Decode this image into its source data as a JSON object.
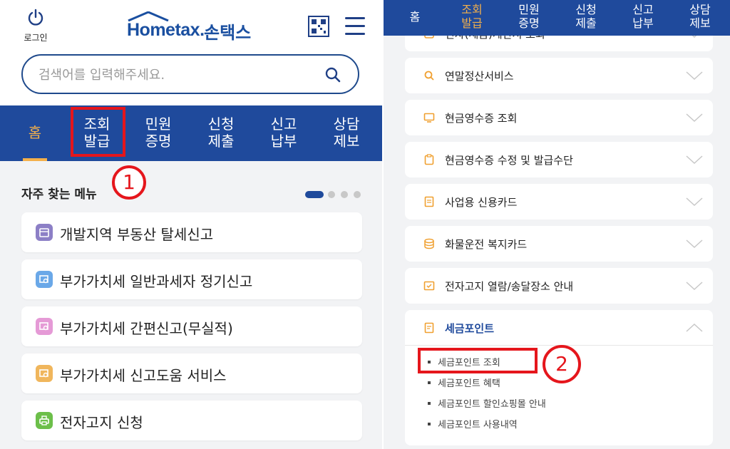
{
  "left": {
    "login_label": "로그인",
    "logo_text": "Hometax.",
    "logo_korean": "손택스",
    "search_placeholder": "검색어를 입력해주세요.",
    "nav": [
      {
        "label1": "홈",
        "label2": "",
        "active": true
      },
      {
        "label1": "조회",
        "label2": "발급",
        "active": false
      },
      {
        "label1": "민원",
        "label2": "증명",
        "active": false
      },
      {
        "label1": "신청",
        "label2": "제출",
        "active": false
      },
      {
        "label1": "신고",
        "label2": "납부",
        "active": false
      },
      {
        "label1": "상담",
        "label2": "제보",
        "active": false
      }
    ],
    "annotation_1": "1",
    "frequent_title": "자주 찾는 메뉴",
    "frequent_items": [
      {
        "label": "개발지역 부동산 탈세신고",
        "icon": "calendar-icon",
        "color": "#8c7fc6"
      },
      {
        "label": "부가가치세 일반과세자 정기신고",
        "icon": "document-search-icon",
        "color": "#6aa8e8"
      },
      {
        "label": "부가가치세 간편신고(무실적)",
        "icon": "document-search-icon",
        "color": "#e59ad6"
      },
      {
        "label": "부가가치세 신고도움 서비스",
        "icon": "document-search-icon",
        "color": "#f0b65c"
      },
      {
        "label": "전자고지 신청",
        "icon": "printer-icon",
        "color": "#6cbf4a"
      }
    ]
  },
  "right": {
    "nav": [
      {
        "label1": "홈",
        "label2": "",
        "active": false
      },
      {
        "label1": "조회",
        "label2": "발급",
        "active": true
      },
      {
        "label1": "민원",
        "label2": "증명",
        "active": false
      },
      {
        "label1": "신청",
        "label2": "제출",
        "active": false
      },
      {
        "label1": "신고",
        "label2": "납부",
        "active": false
      },
      {
        "label1": "상담",
        "label2": "제보",
        "active": false
      }
    ],
    "partial_item": "전자(세금)계산서 조회",
    "menu_items": [
      {
        "label": "연말정산서비스",
        "icon": "search-icon"
      },
      {
        "label": "현금영수증 조회",
        "icon": "monitor-icon"
      },
      {
        "label": "현금영수증 수정 및 발급수단",
        "icon": "clipboard-icon"
      },
      {
        "label": "사업용 신용카드",
        "icon": "document-icon"
      },
      {
        "label": "화물운전 복지카드",
        "icon": "database-icon"
      },
      {
        "label": "전자고지 열람/송달장소 안내",
        "icon": "checkbox-icon"
      }
    ],
    "expanded": {
      "label": "세금포인트",
      "icon": "note-icon",
      "sub_items": [
        "세금포인트 조회",
        "세금포인트 혜택",
        "세금포인트 할인쇼핑몰 안내",
        "세금포인트 사용내역"
      ]
    },
    "annotation_2": "2"
  },
  "colors": {
    "brand_blue": "#1f4a9c",
    "accent_orange": "#f4b04a",
    "annotation_red": "#e5161c"
  }
}
